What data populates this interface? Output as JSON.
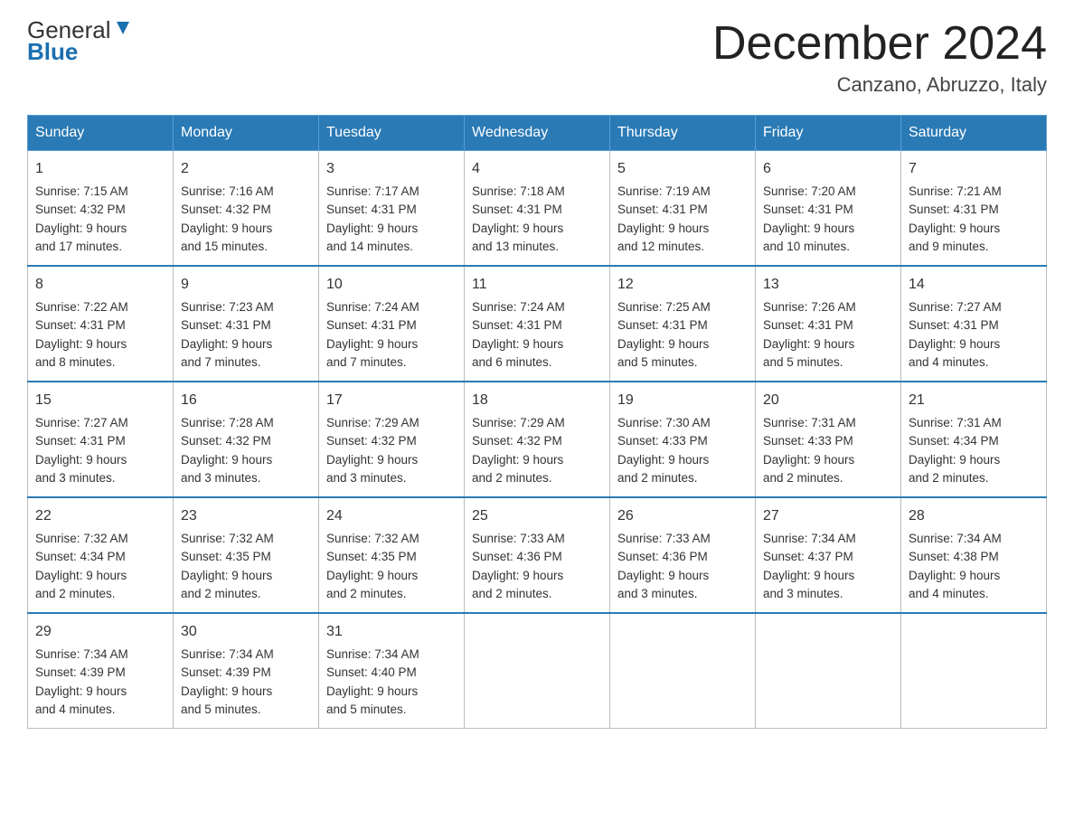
{
  "header": {
    "logo_general": "General",
    "logo_blue": "Blue",
    "title": "December 2024",
    "subtitle": "Canzano, Abruzzo, Italy"
  },
  "days_of_week": [
    "Sunday",
    "Monday",
    "Tuesday",
    "Wednesday",
    "Thursday",
    "Friday",
    "Saturday"
  ],
  "weeks": [
    [
      {
        "day": "1",
        "sunrise": "7:15 AM",
        "sunset": "4:32 PM",
        "daylight": "9 hours and 17 minutes."
      },
      {
        "day": "2",
        "sunrise": "7:16 AM",
        "sunset": "4:32 PM",
        "daylight": "9 hours and 15 minutes."
      },
      {
        "day": "3",
        "sunrise": "7:17 AM",
        "sunset": "4:31 PM",
        "daylight": "9 hours and 14 minutes."
      },
      {
        "day": "4",
        "sunrise": "7:18 AM",
        "sunset": "4:31 PM",
        "daylight": "9 hours and 13 minutes."
      },
      {
        "day": "5",
        "sunrise": "7:19 AM",
        "sunset": "4:31 PM",
        "daylight": "9 hours and 12 minutes."
      },
      {
        "day": "6",
        "sunrise": "7:20 AM",
        "sunset": "4:31 PM",
        "daylight": "9 hours and 10 minutes."
      },
      {
        "day": "7",
        "sunrise": "7:21 AM",
        "sunset": "4:31 PM",
        "daylight": "9 hours and 9 minutes."
      }
    ],
    [
      {
        "day": "8",
        "sunrise": "7:22 AM",
        "sunset": "4:31 PM",
        "daylight": "9 hours and 8 minutes."
      },
      {
        "day": "9",
        "sunrise": "7:23 AM",
        "sunset": "4:31 PM",
        "daylight": "9 hours and 7 minutes."
      },
      {
        "day": "10",
        "sunrise": "7:24 AM",
        "sunset": "4:31 PM",
        "daylight": "9 hours and 7 minutes."
      },
      {
        "day": "11",
        "sunrise": "7:24 AM",
        "sunset": "4:31 PM",
        "daylight": "9 hours and 6 minutes."
      },
      {
        "day": "12",
        "sunrise": "7:25 AM",
        "sunset": "4:31 PM",
        "daylight": "9 hours and 5 minutes."
      },
      {
        "day": "13",
        "sunrise": "7:26 AM",
        "sunset": "4:31 PM",
        "daylight": "9 hours and 5 minutes."
      },
      {
        "day": "14",
        "sunrise": "7:27 AM",
        "sunset": "4:31 PM",
        "daylight": "9 hours and 4 minutes."
      }
    ],
    [
      {
        "day": "15",
        "sunrise": "7:27 AM",
        "sunset": "4:31 PM",
        "daylight": "9 hours and 3 minutes."
      },
      {
        "day": "16",
        "sunrise": "7:28 AM",
        "sunset": "4:32 PM",
        "daylight": "9 hours and 3 minutes."
      },
      {
        "day": "17",
        "sunrise": "7:29 AM",
        "sunset": "4:32 PM",
        "daylight": "9 hours and 3 minutes."
      },
      {
        "day": "18",
        "sunrise": "7:29 AM",
        "sunset": "4:32 PM",
        "daylight": "9 hours and 2 minutes."
      },
      {
        "day": "19",
        "sunrise": "7:30 AM",
        "sunset": "4:33 PM",
        "daylight": "9 hours and 2 minutes."
      },
      {
        "day": "20",
        "sunrise": "7:31 AM",
        "sunset": "4:33 PM",
        "daylight": "9 hours and 2 minutes."
      },
      {
        "day": "21",
        "sunrise": "7:31 AM",
        "sunset": "4:34 PM",
        "daylight": "9 hours and 2 minutes."
      }
    ],
    [
      {
        "day": "22",
        "sunrise": "7:32 AM",
        "sunset": "4:34 PM",
        "daylight": "9 hours and 2 minutes."
      },
      {
        "day": "23",
        "sunrise": "7:32 AM",
        "sunset": "4:35 PM",
        "daylight": "9 hours and 2 minutes."
      },
      {
        "day": "24",
        "sunrise": "7:32 AM",
        "sunset": "4:35 PM",
        "daylight": "9 hours and 2 minutes."
      },
      {
        "day": "25",
        "sunrise": "7:33 AM",
        "sunset": "4:36 PM",
        "daylight": "9 hours and 2 minutes."
      },
      {
        "day": "26",
        "sunrise": "7:33 AM",
        "sunset": "4:36 PM",
        "daylight": "9 hours and 3 minutes."
      },
      {
        "day": "27",
        "sunrise": "7:34 AM",
        "sunset": "4:37 PM",
        "daylight": "9 hours and 3 minutes."
      },
      {
        "day": "28",
        "sunrise": "7:34 AM",
        "sunset": "4:38 PM",
        "daylight": "9 hours and 4 minutes."
      }
    ],
    [
      {
        "day": "29",
        "sunrise": "7:34 AM",
        "sunset": "4:39 PM",
        "daylight": "9 hours and 4 minutes."
      },
      {
        "day": "30",
        "sunrise": "7:34 AM",
        "sunset": "4:39 PM",
        "daylight": "9 hours and 5 minutes."
      },
      {
        "day": "31",
        "sunrise": "7:34 AM",
        "sunset": "4:40 PM",
        "daylight": "9 hours and 5 minutes."
      },
      null,
      null,
      null,
      null
    ]
  ],
  "labels": {
    "sunrise": "Sunrise:",
    "sunset": "Sunset:",
    "daylight": "Daylight:"
  }
}
